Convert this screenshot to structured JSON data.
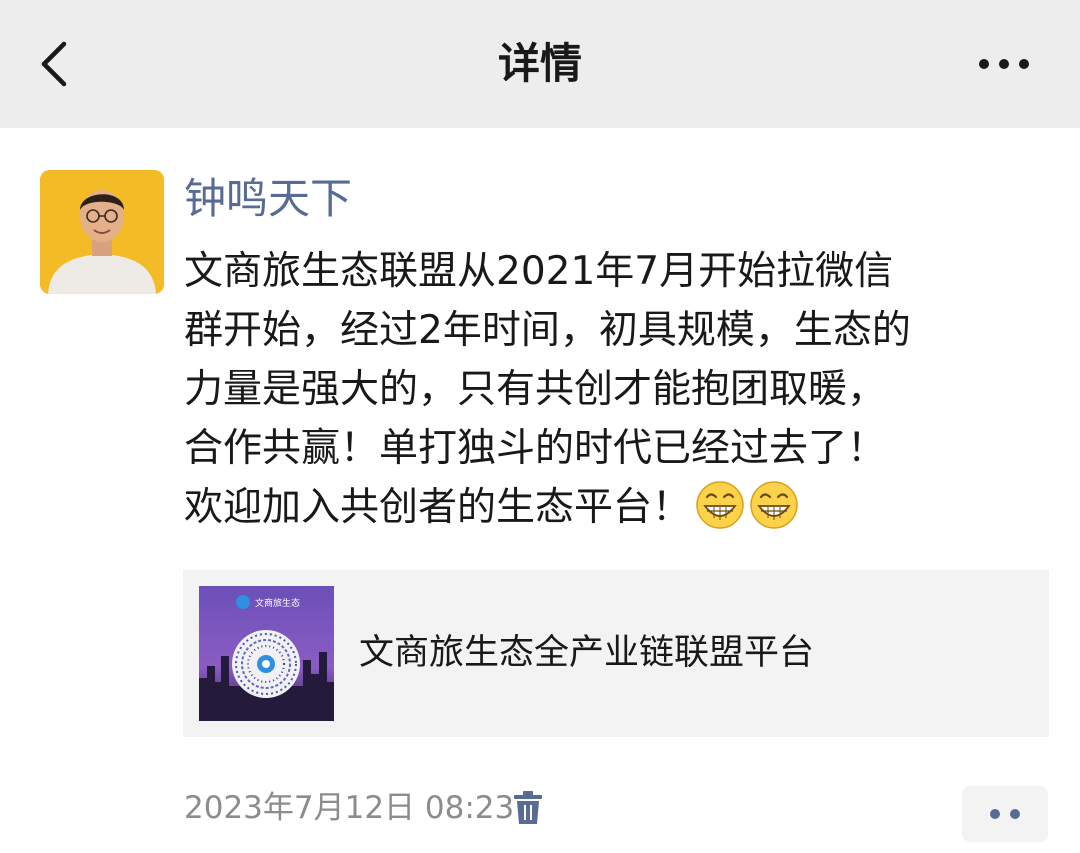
{
  "header": {
    "title": "详情",
    "back_icon": "chevron-left-icon",
    "more_icon": "more-horizontal-icon"
  },
  "post": {
    "author": "钟鸣天下",
    "text_lines": [
      "文商旅生态联盟从2021年7月开始拉微信",
      "群开始，经过2年时间，初具规模，生态的",
      "力量是强大的，只有共创才能抱团取暖，",
      "合作共赢！单打独斗的时代已经过去了！",
      "欢迎加入共创者的生态平台！"
    ],
    "emoji": [
      "grinning-face-icon",
      "grinning-face-icon"
    ],
    "link_card": {
      "title": "文商旅生态全产业链联盟平台",
      "thumbnail_label": "文商旅生态"
    },
    "timestamp": "2023年7月12日 08:23",
    "delete_icon": "trash-icon",
    "comment_icon": "comment-dots-icon"
  },
  "colors": {
    "header_bg": "#ededed",
    "author_name": "#576b95",
    "body_text": "#191919",
    "meta_text": "#8c8c8c",
    "card_bg": "#f3f3f3"
  }
}
